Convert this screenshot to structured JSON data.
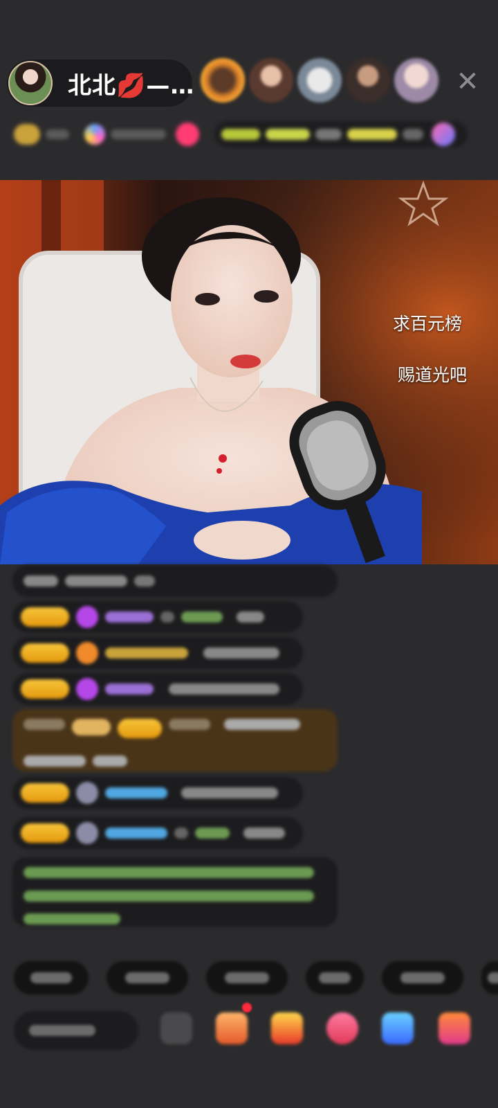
{
  "header": {
    "host_name": "北北💋—…",
    "close_glyph": "✕"
  },
  "stream": {
    "caption_line_1": "求百元榜",
    "caption_line_2": "赐道光吧"
  },
  "colors": {
    "background": "#2b2b2d",
    "level_badge": "#f0b020",
    "chat_bubble": "#1c1c1e",
    "highlight_bubble": "#4a3418",
    "username_purple": "#9b6fd6",
    "username_blue": "#4fa6e0",
    "system_text": "#7fb56a"
  },
  "icons": {
    "close": "close-icon",
    "gem": "gem-icon",
    "fan_club": "fan-club-icon",
    "gift": "gift-icon",
    "red_envelope": "red-envelope-icon",
    "game": "game-icon",
    "box": "box-icon",
    "camera_switch": "camera-icon"
  }
}
